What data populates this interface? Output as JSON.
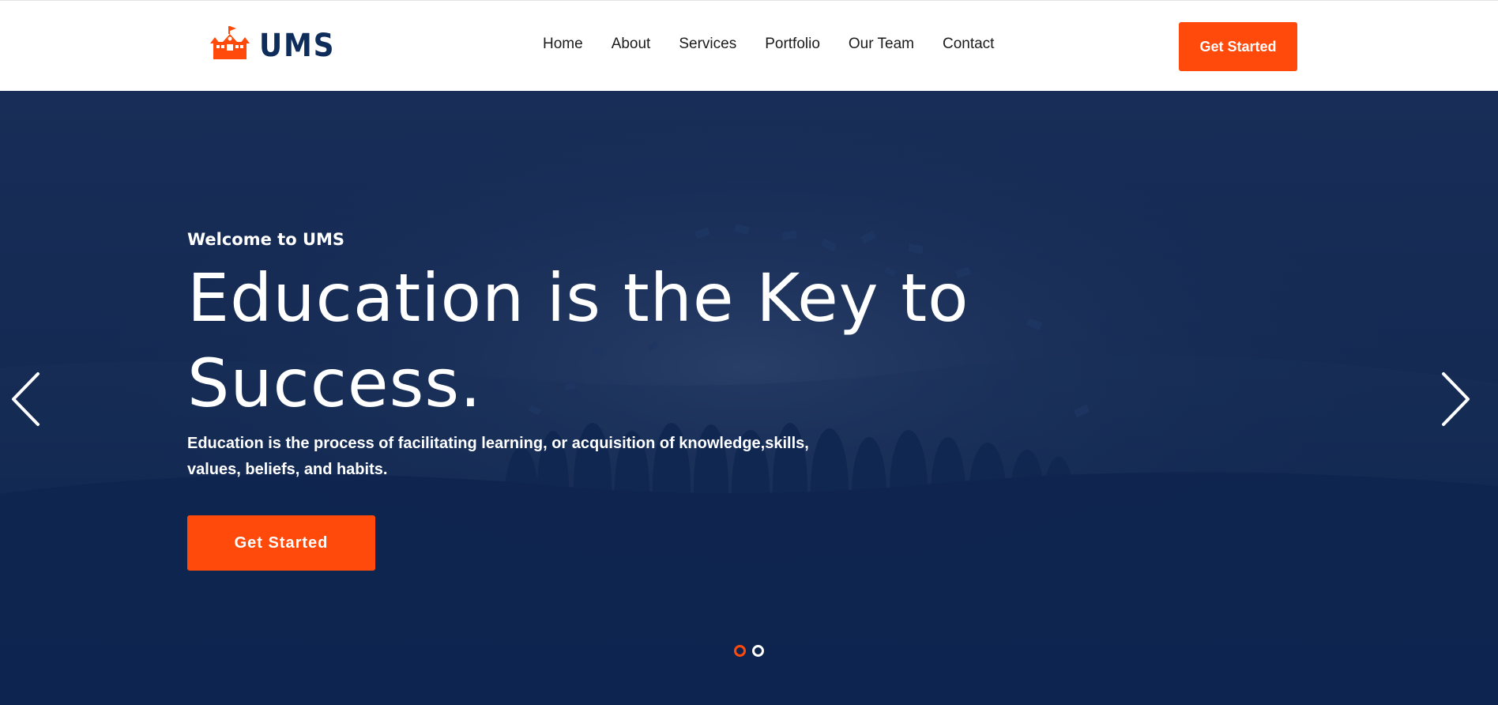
{
  "brand": {
    "name": "UMS",
    "icon_label": "UMS",
    "icon": "school-building-icon",
    "colors": {
      "accent": "#ff4a0b",
      "navy": "#0f2d5a",
      "hero_bg": "#142a53"
    }
  },
  "nav": {
    "items": [
      {
        "label": "Home"
      },
      {
        "label": "About"
      },
      {
        "label": "Services"
      },
      {
        "label": "Portfolio"
      },
      {
        "label": "Our Team"
      },
      {
        "label": "Contact"
      }
    ]
  },
  "header": {
    "cta_label": "Get Started"
  },
  "hero": {
    "eyebrow": "Welcome to UMS",
    "headline": "Education is the Key to Success.",
    "description": "Education is the process of facilitating learning, or acquisition of knowledge,skills, values, beliefs, and habits.",
    "cta_label": "Get Started",
    "background": "graduates-silhouette-throwing-caps"
  },
  "carousel": {
    "prev_icon": "chevron-left-icon",
    "next_icon": "chevron-right-icon",
    "slide_count": 2,
    "active_slide": 1
  }
}
